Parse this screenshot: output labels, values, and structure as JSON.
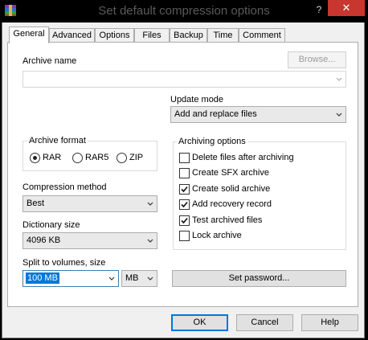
{
  "window": {
    "title": "Set default compression options",
    "help_label": "?",
    "close_label": "✕"
  },
  "tabs": [
    {
      "label": "General",
      "active": true
    },
    {
      "label": "Advanced"
    },
    {
      "label": "Options"
    },
    {
      "label": "Files"
    },
    {
      "label": "Backup"
    },
    {
      "label": "Time"
    },
    {
      "label": "Comment"
    }
  ],
  "general": {
    "archive_name_label": "Archive name",
    "archive_name_value": "",
    "browse_label": "Browse...",
    "update_mode_label": "Update mode",
    "update_mode_value": "Add and replace files",
    "archive_format": {
      "label": "Archive format",
      "options": [
        {
          "label": "RAR",
          "selected": true
        },
        {
          "label": "RAR5",
          "selected": false
        },
        {
          "label": "ZIP",
          "selected": false
        }
      ]
    },
    "compression_method_label": "Compression method",
    "compression_method_value": "Best",
    "dictionary_size_label": "Dictionary size",
    "dictionary_size_value": "4096 KB",
    "split_label": "Split to volumes, size",
    "split_value": "100 MB",
    "split_unit": "MB",
    "archiving_options": {
      "label": "Archiving options",
      "items": [
        {
          "label": "Delete files after archiving",
          "checked": false
        },
        {
          "label": "Create SFX archive",
          "checked": false
        },
        {
          "label": "Create solid archive",
          "checked": true
        },
        {
          "label": "Add recovery record",
          "checked": true
        },
        {
          "label": "Test archived files",
          "checked": true
        },
        {
          "label": "Lock archive",
          "checked": false
        }
      ]
    },
    "set_password_label": "Set password..."
  },
  "footer": {
    "ok_label": "OK",
    "cancel_label": "Cancel",
    "help_label": "Help"
  }
}
